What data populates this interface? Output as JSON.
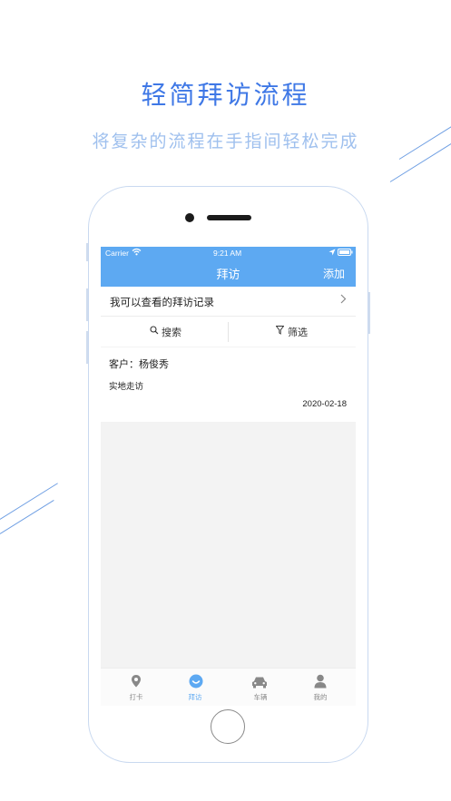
{
  "promo": {
    "title": "轻简拜访流程",
    "subtitle": "将复杂的流程在手指间轻松完成"
  },
  "status_bar": {
    "carrier": "Carrier",
    "time": "9:21 AM"
  },
  "nav": {
    "title": "拜访",
    "add_label": "添加"
  },
  "records_row": {
    "label": "我可以查看的拜访记录"
  },
  "toolbar": {
    "search_label": "搜索",
    "filter_label": "筛选"
  },
  "visit_card": {
    "customer": "客户：杨俊秀",
    "method": "实地走访",
    "date": "2020-02-18"
  },
  "tabs": [
    {
      "label": "打卡",
      "icon": "location-pin-icon",
      "active": false
    },
    {
      "label": "拜访",
      "icon": "smile-icon",
      "active": true
    },
    {
      "label": "车辆",
      "icon": "car-icon",
      "active": false
    },
    {
      "label": "我的",
      "icon": "person-icon",
      "active": false
    }
  ],
  "colors": {
    "accent": "#5da9f2",
    "headline": "#3f78e6",
    "subtitle": "#9fc0ee",
    "tab_inactive": "#888888"
  }
}
